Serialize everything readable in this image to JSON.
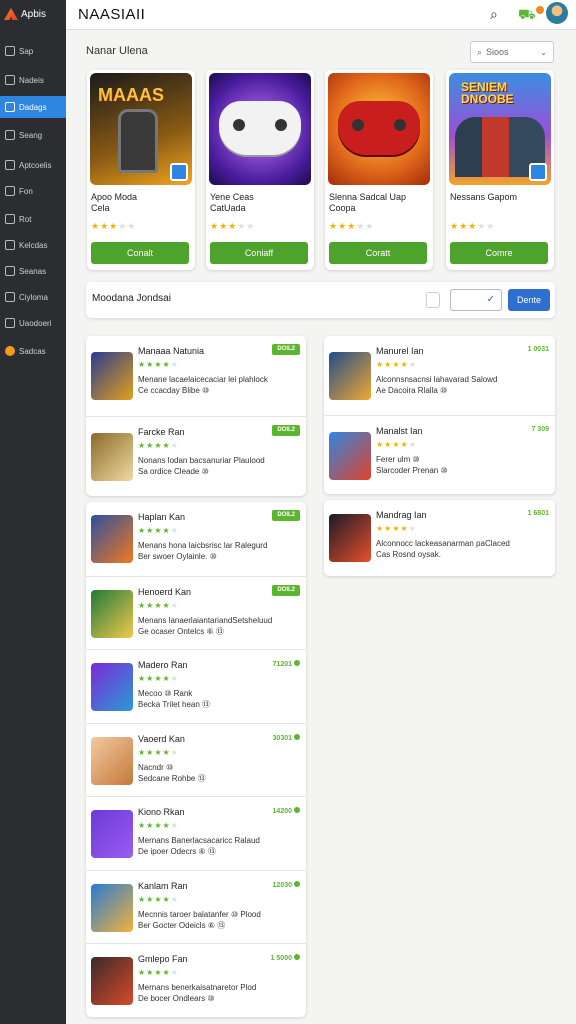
{
  "brand": {
    "name": "Apbis"
  },
  "app": {
    "title": "NAASIAII"
  },
  "sidebar": {
    "items": [
      {
        "label": "Sap",
        "icon": "home-icon"
      },
      {
        "label": "Nadeis",
        "icon": "grid-icon"
      },
      {
        "label": "Dadags",
        "icon": "folder-icon",
        "active": true
      },
      {
        "label": "Seang",
        "icon": "cloud-icon"
      },
      {
        "label": "Aptcoelis",
        "icon": "doc-icon"
      },
      {
        "label": "Fon",
        "icon": "file-icon"
      },
      {
        "label": "Rot",
        "icon": "gear-icon"
      },
      {
        "label": "Kelcdas",
        "icon": "list-icon"
      },
      {
        "label": "Seanas",
        "icon": "tag-icon"
      },
      {
        "label": "Ciyloma",
        "icon": "globe-icon"
      },
      {
        "label": "Uaodoeri",
        "icon": "box-icon"
      },
      {
        "label": "Sadcas",
        "icon": "orange-dot-icon"
      }
    ]
  },
  "featured": {
    "title": "Nanar Ulena",
    "sort_placeholder": "Sioos",
    "cards": [
      {
        "name": "Apoo Moda\nCela",
        "rating": 3,
        "button": "Conalt"
      },
      {
        "name": "Yene Ceas\nCatUada",
        "rating": 3,
        "button": "Coniaff"
      },
      {
        "name": "Slenna Sadcal Uap\nCoopa",
        "rating": 3,
        "button": "Coratt"
      },
      {
        "name": "Nessans Gapom",
        "rating": 3,
        "button": "Comre"
      }
    ],
    "image_texts": {
      "card1": "MAAAS",
      "card4": "SENIEM\nDNOOBE"
    }
  },
  "filter": {
    "label": "Moodana Jondsai",
    "check": "✓",
    "button": "Dente"
  },
  "left_list_1": [
    {
      "name": "Manaaa Natunia",
      "rating": 4,
      "pill": "DOIL2",
      "desc": "Menane lacaelaicecaciar lei plahlock\nCe ccacday Blibe ⑩"
    },
    {
      "name": "Farcke Ran",
      "rating": 4,
      "pill": "DOIL2",
      "desc": "Nonans lodan bacsanuriar Plaulood\nSa ordice Cleade ⑩"
    }
  ],
  "left_list_2": [
    {
      "name": "Haplan Kan",
      "rating": 4,
      "pill": "DOIL2",
      "desc": "Menans hona laicbsrisc lar Ralegurd\nBer swoer Oylainle. ⑩"
    },
    {
      "name": "Henoerd Kan",
      "rating": 4,
      "pill": "DOIL2",
      "desc": "Menans lanaerlaiantariandSetsheluud\nGe ocaser Ontelcs ⑥ ⑬"
    },
    {
      "name": "Madero Ran",
      "rating": 4,
      "score": "71201",
      "desc": "Mecoo ⑩ Rank\nBecka Trilet hean ⑬"
    },
    {
      "name": "Vaoerd Kan",
      "rating": 4,
      "score": "30301",
      "desc": "Nacndr ⑩\nSedcane Rohbe ⑬"
    },
    {
      "name": "Kiono Rkan",
      "rating": 4,
      "score": "14200",
      "desc": "Mernans Banerlacsacaricc Ralaud\nDe ipoer Odecrs ⑥ ⑬"
    },
    {
      "name": "Kanlam Ran",
      "rating": 4,
      "score": "12030",
      "desc": "Mecnnis taroer balatanfer ⑩ Plood\nBer Gocter Odeicls ⑥ ⑬"
    },
    {
      "name": "Gmlepo Fan",
      "rating": 4,
      "score": "1 5000",
      "desc": "Mernans benerkaisatnaretor Plod\nDe bocer Ondlears ⑩"
    }
  ],
  "right_list_1": [
    {
      "name": "Manurel Ian",
      "rating": 4,
      "score": "1 0031",
      "desc": "Alconnsnsacnsi lahavarad Salowd\nAe Dacoira Rlalla ⑩"
    },
    {
      "name": "Manalst Ian",
      "rating": 4,
      "score": "7 309",
      "desc": "Ferer ulm ⑩\nSlarcoder Prenan ⑩"
    }
  ],
  "right_list_2": [
    {
      "name": "Mandrag Ian",
      "rating": 4,
      "score": "1 6801",
      "desc": "Alconnocc lackeasanarman paClaced\nCas Rosnd oysak."
    }
  ]
}
